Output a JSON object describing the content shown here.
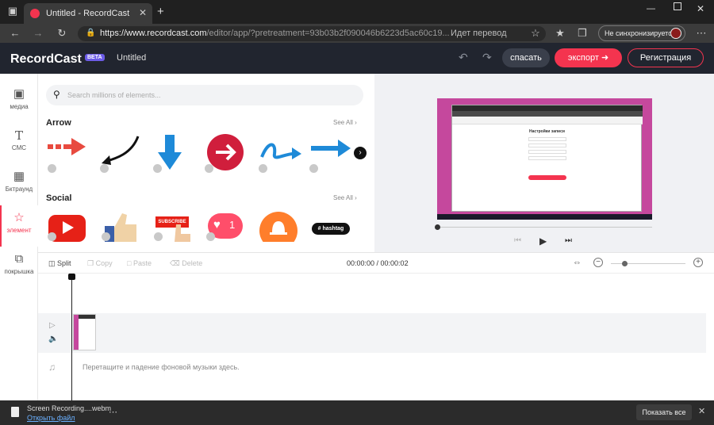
{
  "browser": {
    "tab_title": "Untitled - RecordCast",
    "url_prefix": "https://www.recordcast.com",
    "url_rest": "/editor/app/?pretreatment=93b03b2f090046b6223d5ac60c19...",
    "translate_label": "Идет перевод",
    "sync_label": "Не синхронизируется"
  },
  "app": {
    "logo": "RecordCast",
    "beta": "BETA",
    "doc_title": "Untitled",
    "save_label": "спасать",
    "export_label": "экспорт",
    "register_label": "Регистрация",
    "accent": "#f4344f"
  },
  "sidebar": {
    "items": [
      {
        "label": "медиа",
        "icon": "media-icon"
      },
      {
        "label": "СМС",
        "icon": "text-icon"
      },
      {
        "label": "Бктраунд",
        "icon": "background-icon"
      },
      {
        "label": "элемент",
        "icon": "star-icon"
      },
      {
        "label": "покрышка",
        "icon": "overlay-icon"
      }
    ]
  },
  "library": {
    "search_placeholder": "Search millions of elements...",
    "sections": [
      {
        "title": "Arrow",
        "see_all": "See All"
      },
      {
        "title": "Social",
        "see_all": "See All"
      }
    ],
    "hashtag_label": "hashtag",
    "subscribe_label": "SUBSCRIBE",
    "like_count": "1"
  },
  "preview": {
    "inner_app_title": "Настройки записи",
    "progress": 0
  },
  "editor": {
    "split": "Split",
    "copy": "Copy",
    "paste": "Paste",
    "delete": "Delete",
    "time": "00:00:00 / 00:00:02",
    "music_hint": "Перетащите и падение фоновой музыки здесь."
  },
  "download": {
    "file_name": "Screen Recording....webm",
    "open_label": "Открыть файл",
    "show_all": "Показать все"
  }
}
